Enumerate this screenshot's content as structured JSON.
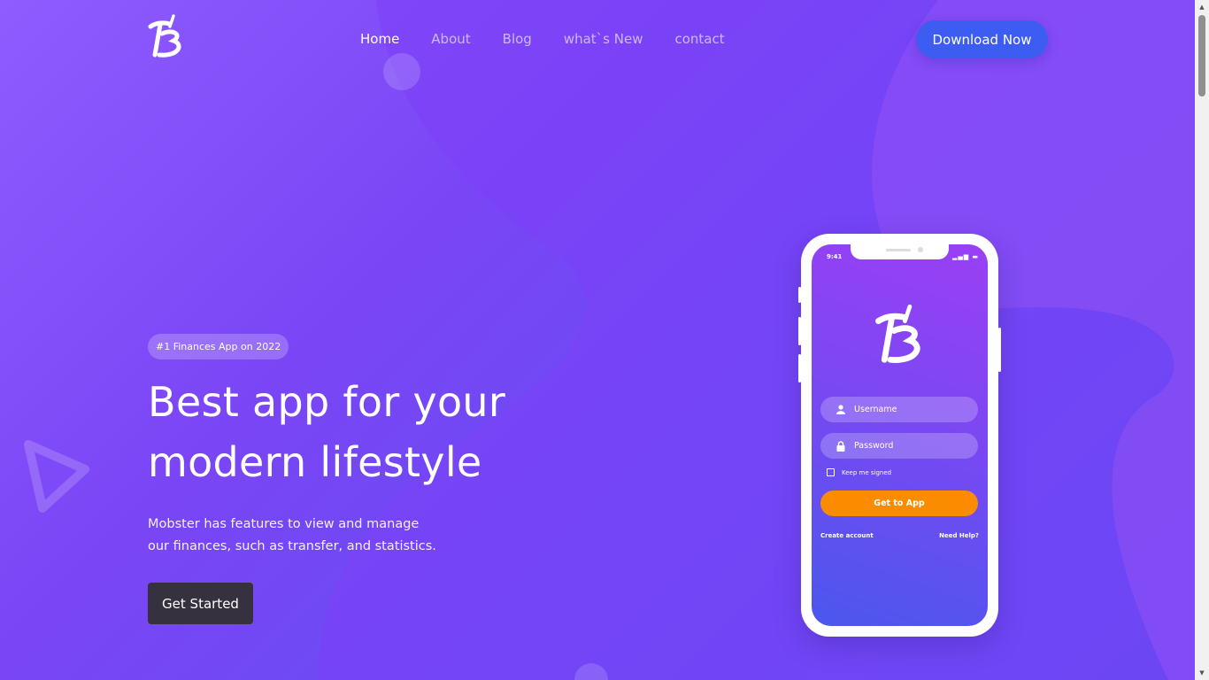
{
  "nav": {
    "items": [
      {
        "label": "Home",
        "active": true
      },
      {
        "label": "About",
        "active": false
      },
      {
        "label": "Blog",
        "active": false
      },
      {
        "label": "what`s New",
        "active": false
      },
      {
        "label": "contact",
        "active": false
      }
    ],
    "cta_label": "Download Now"
  },
  "hero": {
    "badge": "#1 Finances App on 2022",
    "title_line1": "Best app for your",
    "title_line2": "modern lifestyle",
    "desc_line1": "Mobster has features to view and manage",
    "desc_line2": "our finances, such as transfer, and statistics.",
    "button_label": "Get Started"
  },
  "phone": {
    "time": "9:41",
    "username_placeholder": "Username",
    "password_placeholder": "Password",
    "keep_signed": "Keep me signed",
    "cta_label": "Get to App",
    "create_account": "Create account",
    "need_help": "Need Help?"
  },
  "colors": {
    "accent_blue": "#3d5cf2",
    "orange": "#fb8c00",
    "dark_button": "#35313f"
  },
  "icons": [
    "brand-logo-icon",
    "user-icon",
    "lock-icon",
    "play-triangle-icon"
  ]
}
